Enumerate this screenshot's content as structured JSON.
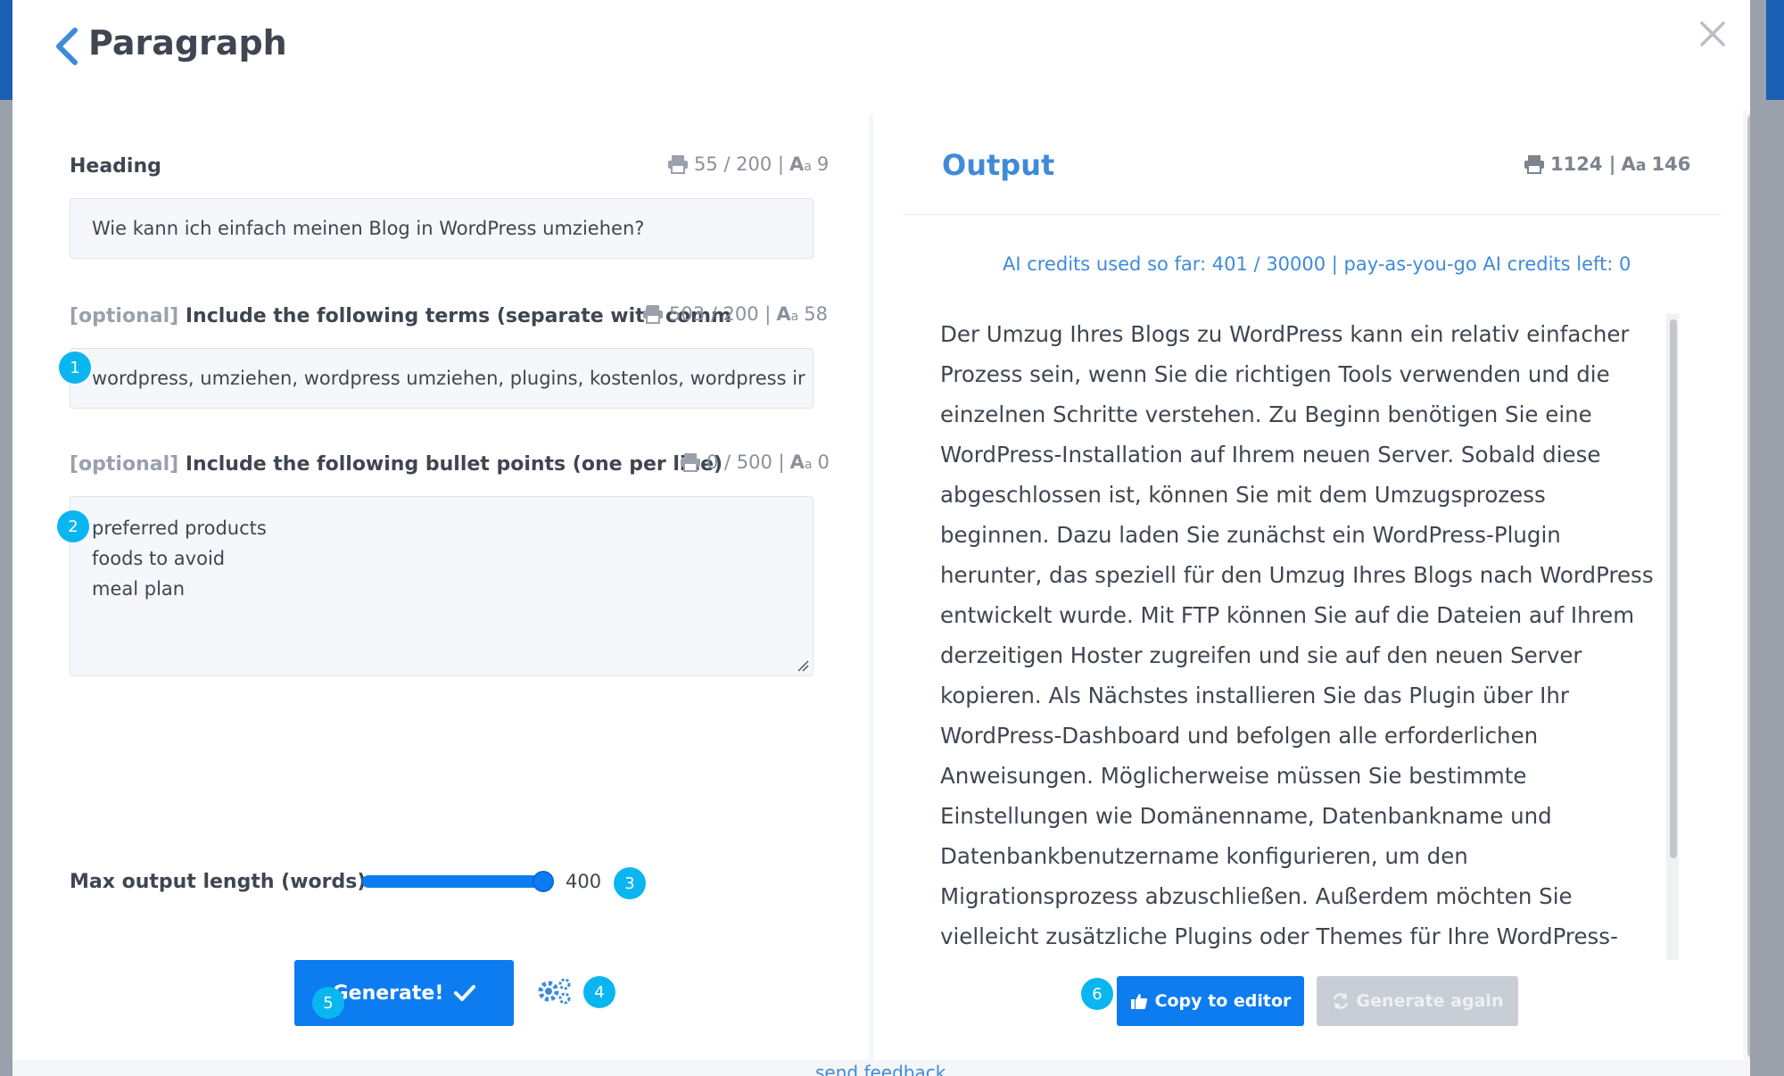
{
  "header": {
    "title": "Paragraph"
  },
  "heading_field": {
    "label": "Heading",
    "counter_chars": "55 / 200 |",
    "counter_words": "9",
    "value": "Wie kann ich einfach meinen Blog in WordPress umziehen?"
  },
  "terms_field": {
    "optional_tag": "[optional]",
    "label": "Include the following terms (separate with comm",
    "counter_chars": "503 / 200 |",
    "counter_words": "58",
    "value": "wordpress, umziehen, wordpress umziehen, plugins, kostenlos, wordpress ir"
  },
  "bullets_field": {
    "optional_tag": "[optional]",
    "label": "Include the following bullet points (one per line)",
    "counter_chars": "0 / 500 |",
    "counter_words": "0",
    "lines": [
      "preferred products",
      "foods to avoid",
      "meal plan"
    ]
  },
  "slider": {
    "label": "Max output length (words):",
    "value": "400",
    "fraction": 1.0
  },
  "generate_button": {
    "label": "Generate!"
  },
  "badges": [
    "1",
    "2",
    "3",
    "4",
    "5",
    "6"
  ],
  "output": {
    "title": "Output",
    "counter_chars": "1124 |",
    "counter_words": "146",
    "credits": "AI credits used so far: 401 / 30000 | pay-as-you-go AI credits left: 0",
    "text": "Der Umzug Ihres Blogs zu WordPress kann ein relativ einfacher Prozess sein, wenn Sie die richtigen Tools verwenden und die einzelnen Schritte verstehen. Zu Beginn benötigen Sie eine WordPress-Installation auf Ihrem neuen Server. Sobald diese abgeschlossen ist, können Sie mit dem Umzugsprozess beginnen. Dazu laden Sie zunächst ein WordPress-Plugin herunter, das speziell für den Umzug Ihres Blogs nach WordPress entwickelt wurde. Mit FTP können Sie auf die Dateien auf Ihrem derzeitigen Hoster zugreifen und sie auf den neuen Server kopieren. Als Nächstes installieren Sie das Plugin über Ihr WordPress-Dashboard und befolgen alle erforderlichen Anweisungen. Möglicherweise müssen Sie bestimmte Einstellungen wie Domänenname, Datenbankname und Datenbankbenutzername konfigurieren, um den Migrationsprozess abzuschließen. Außerdem möchten Sie vielleicht zusätzliche Plugins oder Themes für Ihre WordPress-Website installieren, sobald diese in Betrieb ist. Alle diese Schritte",
    "copy_label": "Copy to editor",
    "again_label": "Generate again"
  },
  "footer": {
    "feedback": "send feedback"
  },
  "colors": {
    "accent": "#0c7cf0",
    "badge": "#0ab6ef",
    "link": "#3f8bd8",
    "text": "#3f4651"
  },
  "icons": [
    "chevron-left-icon",
    "close-icon",
    "printer-icon",
    "font-size-icon",
    "check-icon",
    "gear-icon",
    "thumbs-up-icon",
    "refresh-icon"
  ]
}
